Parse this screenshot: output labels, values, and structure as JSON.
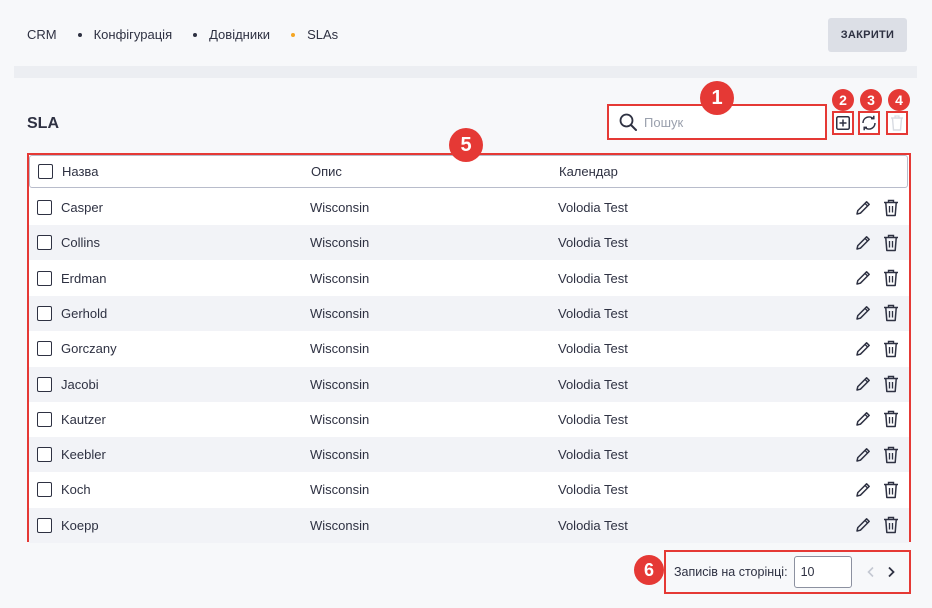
{
  "breadcrumb": {
    "items": [
      "CRM",
      "Конфігурація",
      "Довідники",
      "SLAs"
    ]
  },
  "header": {
    "close_label": "ЗАКРИТИ"
  },
  "page": {
    "title": "SLA"
  },
  "search": {
    "placeholder": "Пошук"
  },
  "badges": [
    "1",
    "2",
    "3",
    "4",
    "5",
    "6"
  ],
  "table": {
    "columns": [
      "Назва",
      "Опис",
      "Календар"
    ],
    "rows": [
      {
        "name": "Casper",
        "description": "Wisconsin",
        "calendar": "Volodia Test"
      },
      {
        "name": "Collins",
        "description": "Wisconsin",
        "calendar": "Volodia Test"
      },
      {
        "name": "Erdman",
        "description": "Wisconsin",
        "calendar": "Volodia Test"
      },
      {
        "name": "Gerhold",
        "description": "Wisconsin",
        "calendar": "Volodia Test"
      },
      {
        "name": "Gorczany",
        "description": "Wisconsin",
        "calendar": "Volodia Test"
      },
      {
        "name": "Jacobi",
        "description": "Wisconsin",
        "calendar": "Volodia Test"
      },
      {
        "name": "Kautzer",
        "description": "Wisconsin",
        "calendar": "Volodia Test"
      },
      {
        "name": "Keebler",
        "description": "Wisconsin",
        "calendar": "Volodia Test"
      },
      {
        "name": "Koch",
        "description": "Wisconsin",
        "calendar": "Volodia Test"
      },
      {
        "name": "Koepp",
        "description": "Wisconsin",
        "calendar": "Volodia Test"
      }
    ]
  },
  "pagination": {
    "label": "Записів на сторінці:",
    "page_size": "10"
  },
  "colors": {
    "annotation": "#e53935",
    "breadcrumb_active_dot": "#f5a623",
    "text": "#2e3142"
  },
  "icons": [
    "search-icon",
    "add-icon",
    "refresh-icon",
    "trash-icon",
    "pencil-icon",
    "chevron-left-icon",
    "chevron-right-icon"
  ]
}
